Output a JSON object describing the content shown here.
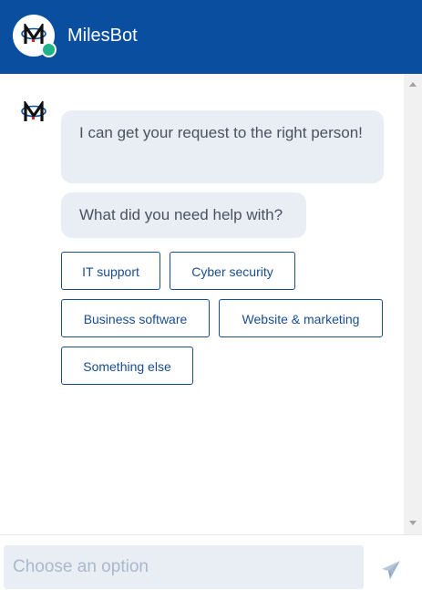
{
  "header": {
    "title": "MilesBot",
    "avatar_icon": "milesbot-logo-icon",
    "status": "online",
    "status_color": "#20b38a",
    "background_color": "#0a4ea0"
  },
  "chat": {
    "bot_icon": "milesbot-logo-icon",
    "messages": [
      "I can get your request to the right person!",
      "What did you need help with?"
    ],
    "options": [
      "IT support",
      "Cyber security",
      "Business software",
      "Website & marketing",
      "Something else"
    ]
  },
  "composer": {
    "placeholder": "Choose an option",
    "send_icon": "send-icon"
  },
  "scrollbar": {
    "up_icon": "scroll-up-arrow-icon",
    "down_icon": "scroll-down-arrow-icon"
  }
}
